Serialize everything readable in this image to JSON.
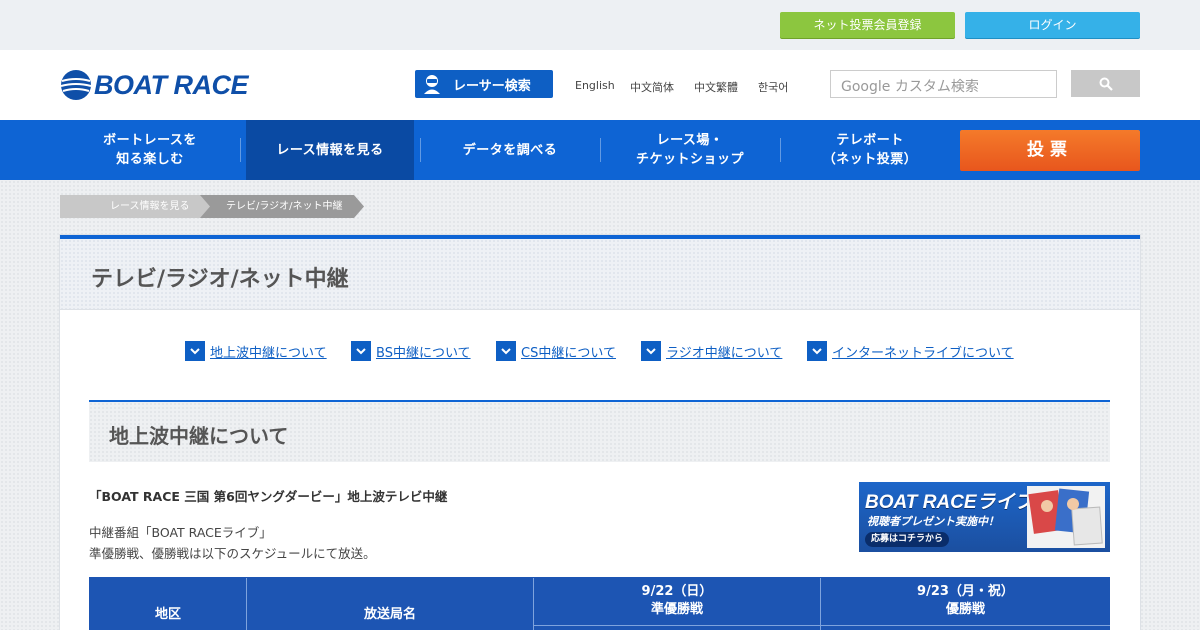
{
  "topbar": {
    "register_label": "ネット投票会員登録",
    "login_label": "ログイン"
  },
  "header": {
    "logo_text": "BOAT RACE",
    "racer_search_label": "レーサー検索",
    "languages": [
      "English",
      "中文简体",
      "中文繁體",
      "한국어"
    ],
    "search_placeholder": "Google カスタム検索",
    "search_icon": "magnifier-icon"
  },
  "nav": {
    "items": [
      {
        "label": "ボートレースを\n知る楽しむ",
        "active": false
      },
      {
        "label": "レース情報を見る",
        "active": true
      },
      {
        "label": "データを調べる",
        "active": false
      },
      {
        "label": "レース場・\nチケットショップ",
        "active": false
      },
      {
        "label": "テレボート\n（ネット投票）",
        "active": false
      }
    ],
    "vote_label": "投票"
  },
  "breadcrumb": [
    "レース情報を見る",
    "テレビ/ラジオ/ネット中継"
  ],
  "page": {
    "title": "テレビ/ラジオ/ネット中継",
    "anchors": [
      "地上波中継について",
      "BS中継について",
      "CS中継について",
      "ラジオ中継について",
      "インターネットライブについて"
    ],
    "section_title": "地上波中継について",
    "event_title": "「BOAT RACE 三国 第6回ヤングダービー」地上波テレビ中継",
    "program": "中継番組「BOAT RACEライブ」",
    "schedule_note": "準優勝戦、優勝戦は以下のスケジュールにて放送。"
  },
  "banner": {
    "line1": "BOAT RACEライブ",
    "line2": "視聴者プレゼント実施中！",
    "line3": "応募はコチラから"
  },
  "table": {
    "col_region": "地区",
    "col_station": "放送局名",
    "col_day1_date": "9/22（日）",
    "col_day1_race": "準優勝戦",
    "col_day2_date": "9/23（月・祝）",
    "col_day2_race": "優勝戦"
  },
  "colors": {
    "brand_blue": "#0e64d4",
    "nav_active": "#0a4aa3",
    "register_green": "#8cc63f",
    "login_cyan": "#35b1e8",
    "vote_orange": "#e8561d"
  }
}
